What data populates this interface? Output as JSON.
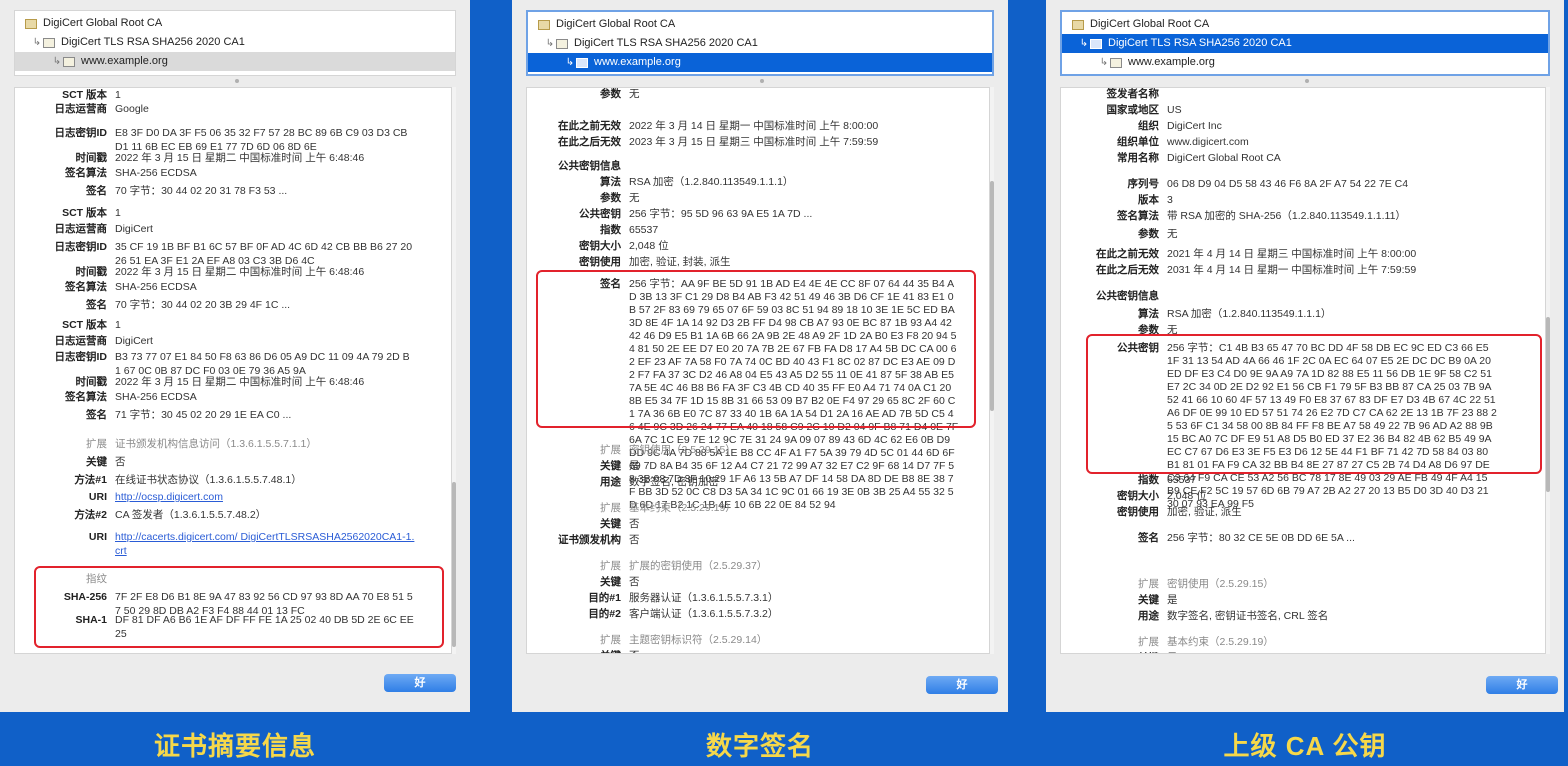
{
  "ok_label": "好",
  "tree": {
    "root": "DigiCert Global Root CA",
    "intermediate": "DigiCert TLS RSA SHA256 2020 CA1",
    "leaf": "www.example.org"
  },
  "panel1": {
    "rows": [
      {
        "label": "SCT 版本",
        "value": "1"
      },
      {
        "label": "日志运营商",
        "value": "Google"
      },
      {
        "label": "日志密钥ID",
        "value": "E8 3F D0 DA 3F F5 06 35 32 F7 57 28 BC 89 6B C9 03 D3 CB D1 11 6B EC EB 69 E1 77 7D 6D 06 8D 6E"
      },
      {
        "label": "时间戳",
        "value": "2022 年 3 月 15 日 星期二 中国标准时间 上午 6:48:46"
      },
      {
        "label": "签名算法",
        "value": "SHA-256 ECDSA"
      },
      {
        "label": "签名",
        "value": "70 字节：30 44 02 20 31 78 F3 53 ..."
      },
      {
        "label": "SCT 版本",
        "value": "1"
      },
      {
        "label": "日志运营商",
        "value": "DigiCert"
      },
      {
        "label": "日志密钥ID",
        "value": "35 CF 19 1B BF B1 6C 57 BF 0F AD 4C 6D 42 CB BB B6 27 20 26 51 EA 3F E1 2A EF A8 03 C3 3B D6 4C"
      },
      {
        "label": "时间戳",
        "value": "2022 年 3 月 15 日 星期二 中国标准时间 上午 6:48:46"
      },
      {
        "label": "签名算法",
        "value": "SHA-256 ECDSA"
      },
      {
        "label": "签名",
        "value": "70 字节：30 44 02 20 3B 29 4F 1C ..."
      },
      {
        "label": "SCT 版本",
        "value": "1"
      },
      {
        "label": "日志运营商",
        "value": "DigiCert"
      },
      {
        "label": "日志密钥ID",
        "value": "B3 73 77 07 E1 84 50 F8 63 86 D6 05 A9 DC 11 09 4A 79 2D B1 67 0C 0B 87 DC F0 03 0E 79 36 A5 9A"
      },
      {
        "label": "时间戳",
        "value": "2022 年 3 月 15 日 星期二 中国标准时间 上午 6:48:46"
      },
      {
        "label": "签名算法",
        "value": "SHA-256 ECDSA"
      },
      {
        "label": "签名",
        "value": "71 字节：30 45 02 20 29 1E EA C0 ..."
      },
      {
        "label": "扩展",
        "value": "证书颁发机构信息访问（1.3.6.1.5.5.7.1.1）",
        "dim": true
      },
      {
        "label": "关键",
        "value": "否"
      },
      {
        "label": "方法#1",
        "value": "在线证书状态协议（1.3.6.1.5.5.7.48.1）"
      },
      {
        "label": "URI",
        "value": "http://ocsp.digicert.com",
        "link": true
      },
      {
        "label": "方法#2",
        "value": "CA 签发者（1.3.6.1.5.5.7.48.2）"
      },
      {
        "label": "URI",
        "value": "http://cacerts.digicert.com/ DigiCertTLSRSASHA2562020CA1-1.crt",
        "link": true
      },
      {
        "label": "指纹",
        "value": "",
        "dim": true
      },
      {
        "label": "SHA-256",
        "value": "7F 2F E8 D6 B1 8E 9A 47 83 92 56 CD 97 93 8D AA 70 E8 51 57 50 29 8D DB A2 F3 F4 88 44 01 13 FC"
      },
      {
        "label": "SHA-1",
        "value": "DF 81 DF A6 B6 1E AF DF FF FE 1A 25 02 40 DB 5D 2E 6C EE 25"
      }
    ],
    "caption": "证书摘要信息"
  },
  "panel2": {
    "rows": [
      {
        "label": "参数",
        "value": "无"
      },
      {
        "label": "在此之前无效",
        "value": "2022 年 3 月 14 日 星期一 中国标准时间 上午 8:00:00"
      },
      {
        "label": "在此之后无效",
        "value": "2023 年 3 月 15 日 星期三 中国标准时间 上午 7:59:59"
      },
      {
        "label": "公共密钥信息",
        "value": ""
      },
      {
        "label": "算法",
        "value": "RSA 加密（1.2.840.113549.1.1.1）"
      },
      {
        "label": "参数",
        "value": "无"
      },
      {
        "label": "公共密钥",
        "value": "256 字节：95 5D 96 63 9A E5 1A 7D ..."
      },
      {
        "label": "指数",
        "value": "65537"
      },
      {
        "label": "密钥大小",
        "value": "2,048 位"
      },
      {
        "label": "密钥使用",
        "value": "加密, 验证, 封装, 派生"
      },
      {
        "label": "签名",
        "value": "256 字节：AA 9F BE 5D 91 1B AD E4 4E 4E CC 8F 07 64 44 35 B4 AD 3B 13 3F C1 29 D8 B4 AB F3 42 51 49 46 3B D6 CF 1E 41 83 E1 0B 57 2F 83 69 79 65 07 6F 59 03 8C 51 94 89 18 10 3E 1E 5C ED BA 3D 8E 4F 1A 14 92 D3 2B FF D4 98 CB A7 93 0E BC 87 1B 93 A4 42 42 46 D9 E5 B1 1A 6B 66 2A 9B 2E 48 A9 2F 1D 2A B0 E3 F8 20 94 54 81 50 2E EE D7 E0 20 7A 7B 2E 67 FB FA D8 17 A4 5B DC CA 00 62 EF 23 AF 7A 58 F0 7A 74 0C BD 40 43 F1 8C 02 87 DC E3 AE 09 D2 F7 FA 37 3C D2 46 A8 04 E5 43 A5 D2 55 11 0E 41 87 5F 38 AB E5 7A 5E 4C 46 B8 B6 FA 3F C3 4B CD 40 35 FF E0 A4 71 74 0A C1 20 8B E5 34 7F 1D 15 8B 31 66 53 09 B7 B2 0E F4 97 29 65 8C 2F 60 C1 7A 36 6B E0 7C 87 33 40 1B 6A 1A 54 D1 2A 16 AE AD 7B 5D C5 46 4E 9C 3D 26 24 77 EA 40 18 58 C9 2C 10 D2 04 9F B8 71 D4 0E 7F 6A 7C 1C E9 7E 12 9C 7E 31 24 9A 09 07 89 43 6D 4C 62 E6 0B D9 DD 9C 4A 7D 88 5A 1E B8 CC 4F A1 F7 5A 39 79 4D 5C 01 44 6D 6F 69 7D 8A B4 35 6F 12 A4 C7 21 72 99 A7 32 E7 C2 9F 68 14 D7 7F 58 3B 08 7D 3F 10 29 1F A6 13 5B A7 DF 14 58 DA 8D DE B8 8E 38 7F BB 3D 52 0C C8 D3 5A 34 1C 9C 01 66 19 3E 0B 3B 25 A4 55 32 5D 6D 17 B2 1C 1B 4E 10 6B 22 0E 84 52 94"
      },
      {
        "label": "扩展",
        "value": "密钥使用（2.5.29.15）",
        "dim": true
      },
      {
        "label": "关键",
        "value": "是"
      },
      {
        "label": "用途",
        "value": "数字签名, 密钥加密"
      },
      {
        "label": "扩展",
        "value": "基本约束（2.5.29.19）",
        "dim": true
      },
      {
        "label": "关键",
        "value": "否"
      },
      {
        "label": "证书颁发机构",
        "value": "否"
      },
      {
        "label": "扩展",
        "value": "扩展的密钥使用（2.5.29.37）",
        "dim": true
      },
      {
        "label": "关键",
        "value": "否"
      },
      {
        "label": "目的#1",
        "value": "服务器认证（1.3.6.1.5.5.7.3.1）"
      },
      {
        "label": "目的#2",
        "value": "客户端认证（1.3.6.1.5.5.7.3.2）"
      },
      {
        "label": "扩展",
        "value": "主题密钥标识符（2.5.29.14）",
        "dim": true
      },
      {
        "label": "关键",
        "value": "否"
      }
    ],
    "caption": "数字签名"
  },
  "panel3": {
    "rows": [
      {
        "label": "签发者名称",
        "value": ""
      },
      {
        "label": "国家或地区",
        "value": "US"
      },
      {
        "label": "组织",
        "value": "DigiCert Inc"
      },
      {
        "label": "组织单位",
        "value": "www.digicert.com"
      },
      {
        "label": "常用名称",
        "value": "DigiCert Global Root CA"
      },
      {
        "label": "序列号",
        "value": "06 D8 D9 04 D5 58 43 46 F6 8A 2F A7 54 22 7E C4"
      },
      {
        "label": "版本",
        "value": "3"
      },
      {
        "label": "签名算法",
        "value": "带 RSA 加密的 SHA-256（1.2.840.113549.1.1.11）"
      },
      {
        "label": "参数",
        "value": "无"
      },
      {
        "label": "在此之前无效",
        "value": "2021 年 4 月 14 日 星期三 中国标准时间 上午 8:00:00"
      },
      {
        "label": "在此之后无效",
        "value": "2031 年 4 月 14 日 星期一 中国标准时间 上午 7:59:59"
      },
      {
        "label": "公共密钥信息",
        "value": ""
      },
      {
        "label": "算法",
        "value": "RSA 加密（1.2.840.113549.1.1.1）"
      },
      {
        "label": "参数",
        "value": "无"
      },
      {
        "label": "公共密钥",
        "value": "256 字节：C1 4B B3 65 47 70 BC DD 4F 58 DB EC 9C ED C3 66 E5 1F 31 13 54 AD 4A 66 46 1F 2C 0A EC 64 07 E5 2E DC DC B9 0A 20 ED DF E3 C4 D0 9E 9A A9 7A 1D 82 88 E5 11 56 DB 1E 9F 58 C2 51 E7 2C 34 0D 2E D2 92 E1 56 CB F1 79 5F B3 BB 87 CA 25 03 7B 9A 52 41 66 10 60 4F 57 13 49 F0 E8 37 67 83 DF E7 D3 4B 67 4C 22 51 A6 DF 0E 99 10 ED 57 51 74 26 E2 7D C7 CA 62 2E 13 1B 7F 23 88 25 53 6F C1 34 58 00 8B 84 FF F8 BE A7 58 49 22 7B 96 AD A2 88 9B 15 BC A0 7C DF E9 51 A8 D5 B0 ED 37 E2 36 B4 82 4B 62 B5 49 9A EC C7 67 D6 E3 3E F5 E3 D6 12 5E 44 F1 BF 71 42 7D 58 84 03 80 B1 81 01 FA F9 CA 32 BB B4 8E 27 87 27 C5 2B 74 D4 A8 D6 97 DE C3 64 F9 CA CE 53 A2 56 BC 78 17 8E 49 03 29 AE FB 49 4F A4 15 B9 CE F2 5C 19 57 6D 6B 79 A7 2B A2 27 20 13 B5 D0 3D 40 D3 21 30 07 93 EA 99 F5"
      },
      {
        "label": "指数",
        "value": "65537"
      },
      {
        "label": "密钥大小",
        "value": "2,048 位"
      },
      {
        "label": "密钥使用",
        "value": "加密, 验证, 派生"
      },
      {
        "label": "签名",
        "value": "256 字节：80 32 CE 5E 0B DD 6E 5A ..."
      },
      {
        "label": "扩展",
        "value": "密钥使用（2.5.29.15）",
        "dim": true
      },
      {
        "label": "关键",
        "value": "是"
      },
      {
        "label": "用途",
        "value": "数字签名, 密钥证书签名, CRL 签名"
      },
      {
        "label": "扩展",
        "value": "基本约束（2.5.29.19）",
        "dim": true
      },
      {
        "label": "关键",
        "value": "是"
      }
    ],
    "caption": "上级 CA 公钥"
  }
}
